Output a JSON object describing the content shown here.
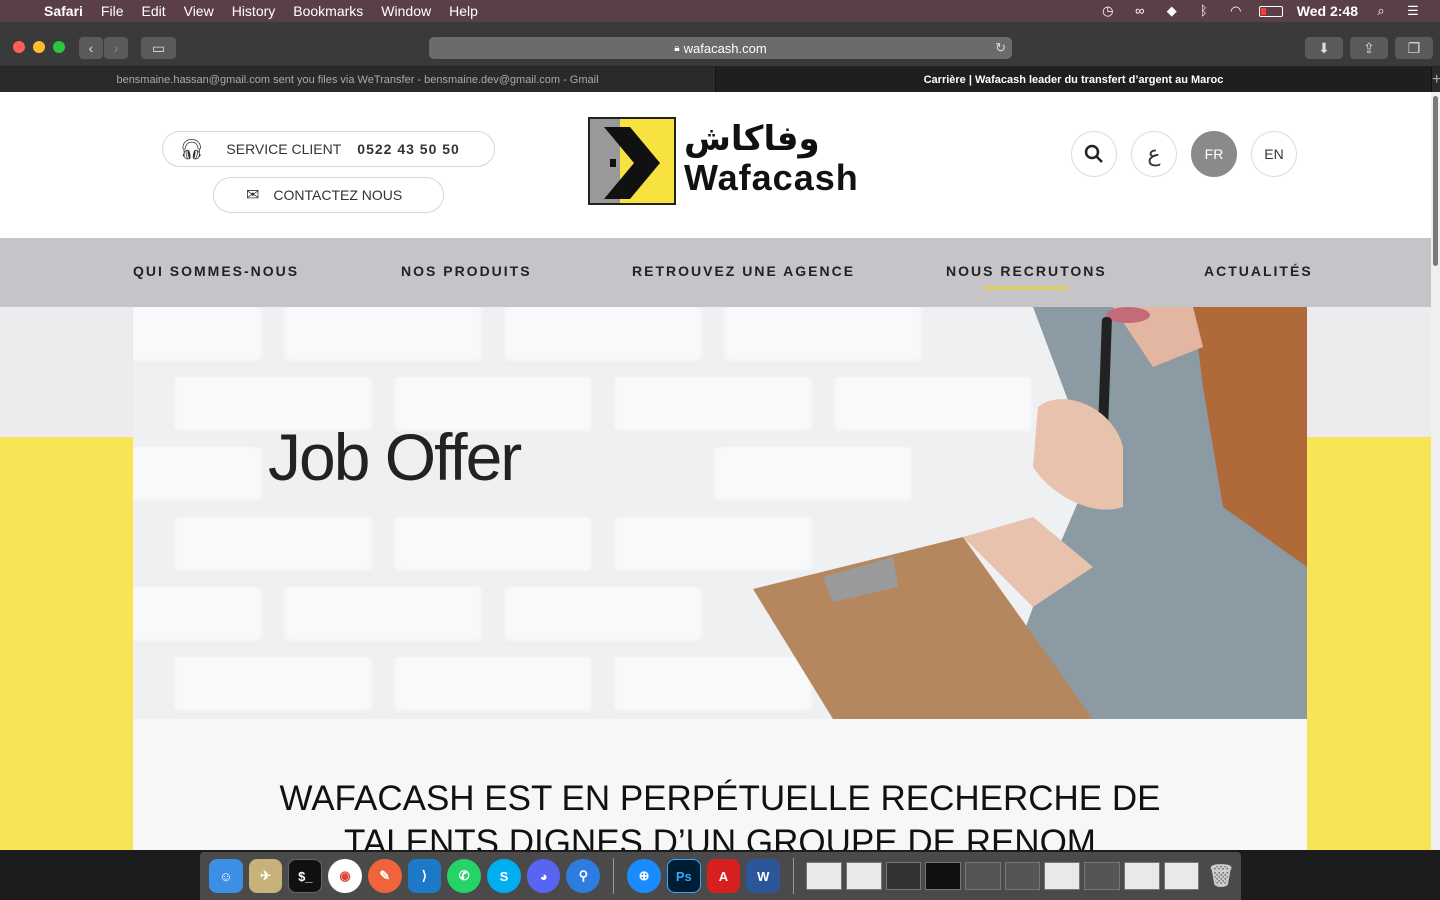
{
  "menubar": {
    "app": "Safari",
    "items": [
      "File",
      "Edit",
      "View",
      "History",
      "Bookmarks",
      "Window",
      "Help"
    ],
    "clock": "Wed 2:48"
  },
  "browser": {
    "url": "wafacash.com",
    "tabs": [
      {
        "title": "bensmaine.hassan@gmail.com sent you files via WeTransfer - bensmaine.dev@gmail.com - Gmail",
        "active": false
      },
      {
        "title": "Carrière | Wafacash leader du transfert d’argent au Maroc",
        "active": true
      }
    ]
  },
  "header": {
    "service_label": "SERVICE CLIENT",
    "service_phone": "0522 43 50 50",
    "contact_label": "CONTACTEZ NOUS",
    "logo_arabic": "وفاكاش",
    "logo_text": "Wafacash",
    "arabic_toggle": "ع",
    "lang_fr": "FR",
    "lang_en": "EN"
  },
  "nav": {
    "items": [
      "QUI SOMMES-NOUS",
      "NOS PRODUITS",
      "RETROUVEZ UNE AGENCE",
      "NOUS RECRUTONS",
      "ACTUALITÉS"
    ],
    "active": "NOUS RECRUTONS",
    "accent": "#f5d20a"
  },
  "hero": {
    "title": "Job Offer"
  },
  "main": {
    "headline_line1": "WAFACASH EST EN PERPÉTUELLE RECHERCHE DE",
    "headline_line2": "TALENTS DIGNES D’UN GROUPE DE RENOM"
  },
  "colors": {
    "brand_yellow": "#f8e556",
    "nav_grey": "#c4c4c9"
  }
}
